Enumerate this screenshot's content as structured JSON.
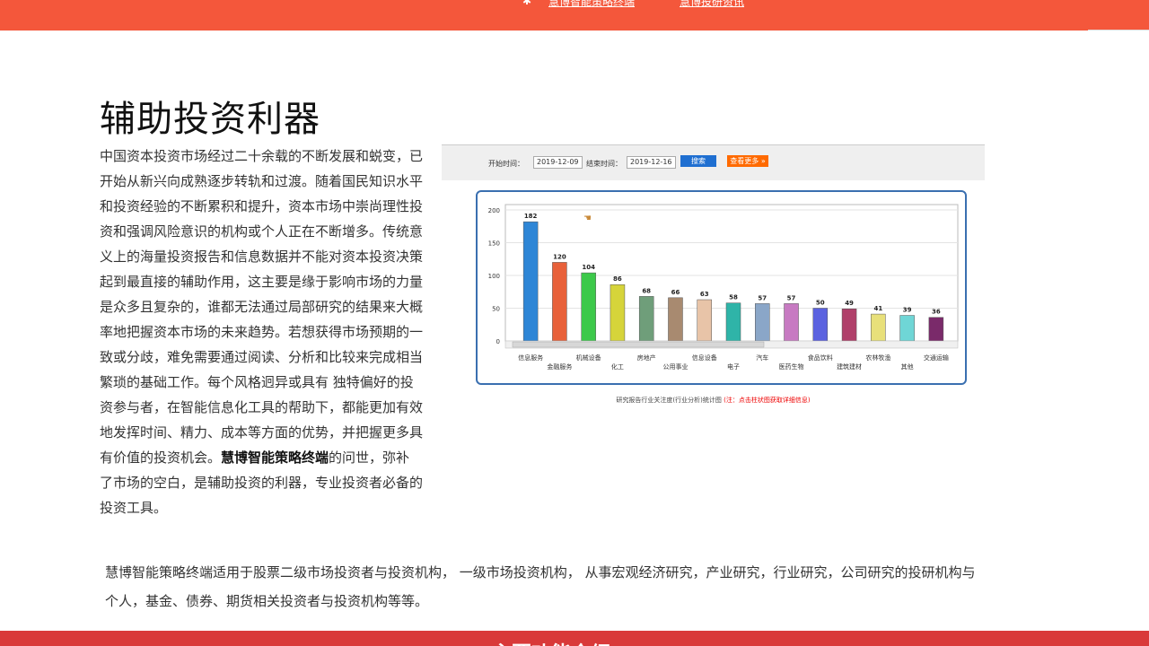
{
  "topbar": {
    "link1": "慧博智能策略终端",
    "link2": "慧博投研资讯"
  },
  "section": {
    "title": "辅助投资利器",
    "intro_p1": "中国资本投资市场经过二十余载的不断发展和蜕变，已开始从新兴向成熟逐步转轨和过渡。随着国民知识水平和投资经验的不断累积和提升，资本市场中崇尚理性投资和强调风险意识的机构或个人正在不断增多。传统意义上的海量投资报告和信息数据并不能对资本投资决策起到最直接的辅助作用，这主要是缘于影响市场的力量是众多且复杂的，谁都无法通过局部研究的结果来大概率地把握资本市场的未来趋势。若想获得市场预期的一致或分歧，难免需要通过阅读、分析和比较来完成相当繁琐的基础工作。每个风格迥异或具有 独特偏好的投资参与者，在智能信息化工具的帮助下，都能更加有效地发挥时间、精力、成本等方面的优势，并把握更多具有价值的投资机会。",
    "intro_highlight": "慧博智能策略终端",
    "intro_p2": "的问世，弥补了市场的空白，是辅助投资的利器，专业投资者必备的投资工具。",
    "para2": "慧博智能策略终端适用于股票二级市场投资者与投资机构， 一级市场投资机构， 从事宏观经济研究，产业研究，行业研究，公司研究的投研机构与个人，基金、债券、期货相关投资者与投资机构等等。"
  },
  "screenshot": {
    "start_label": "开始时间：",
    "start_value": "2019-12-09",
    "end_label": "结束时间：",
    "end_value": "2019-12-16",
    "search_btn": "搜索",
    "more_btn": "查看更多 »",
    "caption": "研究报告行业关注度(行业分析)统计图",
    "caption_warn": "(注：点击柱状图获取详细信息)"
  },
  "chart_data": {
    "type": "bar",
    "categories": [
      "信息服务",
      "金融服务",
      "机械设备",
      "化工",
      "房地产",
      "公用事业",
      "信息设备",
      "电子",
      "汽车",
      "医药生物",
      "食品饮料",
      "建筑建材",
      "农林牧渔",
      "其他",
      "交通运输"
    ],
    "values": [
      182,
      120,
      104,
      86,
      68,
      66,
      63,
      58,
      57,
      57,
      50,
      49,
      41,
      39,
      36
    ],
    "colors": [
      "#2e86d6",
      "#e8613a",
      "#3cc94a",
      "#d6d43a",
      "#6f9e7a",
      "#a88a70",
      "#e8c4a8",
      "#2fb4a8",
      "#8aa6c8",
      "#c77ac2",
      "#5b62e0",
      "#b0406a",
      "#e8e07a",
      "#6fd6d6",
      "#7a2a6a"
    ],
    "ylim": [
      0,
      200
    ],
    "yticks": [
      0,
      50,
      100,
      150,
      200
    ]
  },
  "bottom": {
    "title": "主要功能介绍"
  }
}
